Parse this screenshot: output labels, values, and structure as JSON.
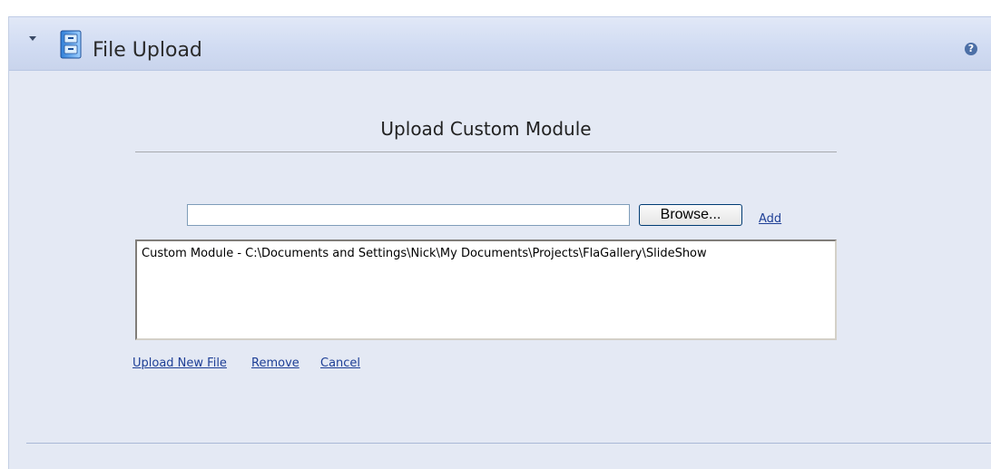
{
  "panel": {
    "title": "File Upload",
    "help_symbol": "?",
    "icons": {
      "toggle": "chevron-down-icon",
      "module": "file-cabinet-icon",
      "help": "help-icon"
    }
  },
  "upload": {
    "section_title": "Upload Custom Module",
    "file_input_value": "",
    "browse_label": "Browse...",
    "add_label": "Add",
    "file_list": [
      "Custom Module - C:\\Documents and Settings\\Nick\\My Documents\\Projects\\FlaGallery\\SlideShow"
    ],
    "actions": {
      "upload_new_file": "Upload New File",
      "remove": "Remove",
      "cancel": "Cancel"
    }
  },
  "colors": {
    "panel_bg": "#e4e9f4",
    "header_bg": "#d0dbf2",
    "link": "#1e3f96"
  }
}
